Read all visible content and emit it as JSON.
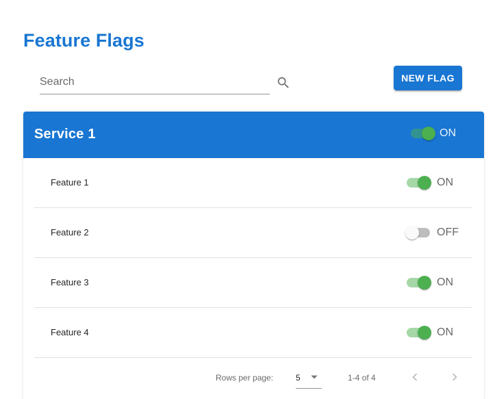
{
  "page": {
    "title": "Feature Flags"
  },
  "search": {
    "placeholder": "Search",
    "value": ""
  },
  "toolbar": {
    "new_flag_label": "NEW FLAG"
  },
  "colors": {
    "primary": "#1976d2",
    "switch_on": "#4caf50"
  },
  "service": {
    "name": "Service 1",
    "enabled": true,
    "state_label": "ON"
  },
  "features": [
    {
      "name": "Feature 1",
      "enabled": true,
      "state_label": "ON"
    },
    {
      "name": "Feature 2",
      "enabled": false,
      "state_label": "OFF"
    },
    {
      "name": "Feature 3",
      "enabled": true,
      "state_label": "ON"
    },
    {
      "name": "Feature 4",
      "enabled": true,
      "state_label": "ON"
    }
  ],
  "pagination": {
    "rows_per_page_label": "Rows per page:",
    "rows_per_page_value": "5",
    "range_label": "1-4 of 4"
  },
  "icons": {
    "search": "search-icon",
    "caret": "arrow-drop-down-icon",
    "prev": "chevron-left-icon",
    "next": "chevron-right-icon"
  }
}
